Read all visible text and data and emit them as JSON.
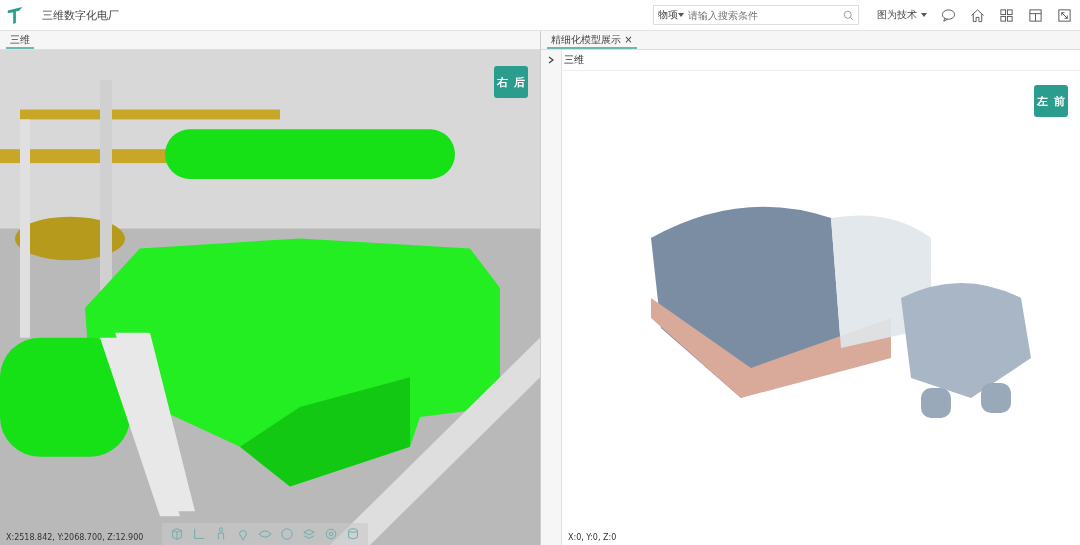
{
  "header": {
    "app_title": "三维数字化电厂",
    "search": {
      "scope": "物项",
      "placeholder": "请输入搜索条件"
    },
    "user": "图为技术"
  },
  "left_panel": {
    "tabs": [
      {
        "label": "三维",
        "selected": true
      }
    ],
    "view_cube": {
      "faces": [
        "右",
        "后"
      ]
    },
    "coordinates": "X:2518.842, Y:2068.700, Z:12.900"
  },
  "right_panel": {
    "tabs": [
      {
        "label": "精细化模型展示",
        "close": "×",
        "selected": true
      }
    ],
    "tree": {
      "label": "三维",
      "expanded": false
    },
    "view_cube": {
      "faces": [
        "左",
        "前"
      ]
    },
    "coordinates": "X:0, Y:0, Z:0"
  }
}
